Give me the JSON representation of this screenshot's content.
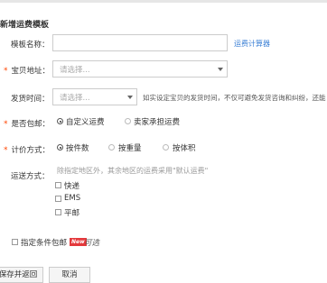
{
  "form": {
    "title": "新增运费模板",
    "template_name": {
      "label": "模板名称：",
      "value": "",
      "link": "运费计算器"
    },
    "location": {
      "label": "宝贝地址：",
      "placeholder": "请选择..."
    },
    "ship_time": {
      "label": "发货时间：",
      "placeholder": "请选择...",
      "hint": "如实设定宝贝的发货时间，不仅可避免发货咨询和纠纷，还能"
    },
    "free_shipping": {
      "label": "是否包邮：",
      "options": [
        "自定义运费",
        "卖家承担运费"
      ],
      "selected": 0
    },
    "pricing": {
      "label": "计价方式：",
      "options": [
        "按件数",
        "按重量",
        "按体积"
      ],
      "selected": 0
    },
    "delivery": {
      "label": "运送方式：",
      "hint": "除指定地区外，其余地区的运费采用\"默认运费\"",
      "options": [
        "快递",
        "EMS",
        "平邮"
      ]
    },
    "conditional": {
      "label": "指定条件包邮",
      "badge": "New",
      "suffix": "可选"
    }
  },
  "actions": {
    "save": "保存并返回",
    "cancel": "取消"
  }
}
